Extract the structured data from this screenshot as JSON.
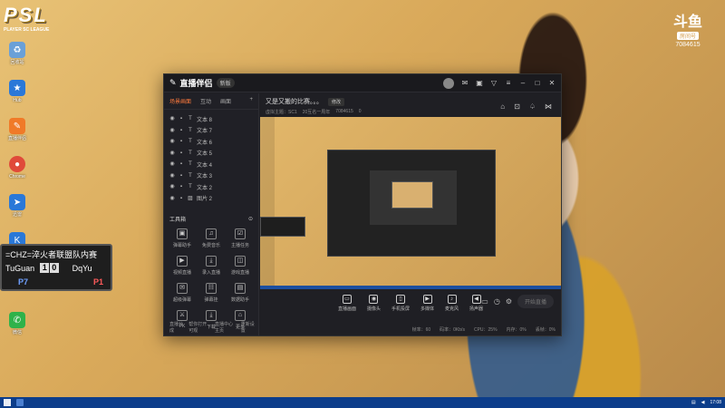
{
  "overlay": {
    "psl_logo_text": "PSL",
    "psl_subtitle": "PLAYER SC LEAGUE",
    "douyu_mark": "斗鱼",
    "douyu_tag": "房间号",
    "douyu_room": "7084615"
  },
  "desktop_icons": [
    {
      "label": "回收站",
      "color": "#6aa0d8",
      "icon": "recycle-bin-icon"
    },
    {
      "label": "Hub",
      "color": "#2a78d8",
      "icon": "star-icon"
    },
    {
      "label": "直播伴侣",
      "color": "#f07a28",
      "icon": "stream-companion-icon"
    },
    {
      "label": "Chrome",
      "color": "#e04a3a",
      "icon": "chrome-icon"
    },
    {
      "label": "迅雷",
      "color": "#2a78d8",
      "icon": "thunder-icon"
    },
    {
      "label": "KK",
      "color": "#2a78d8",
      "icon": "kk-icon"
    },
    {
      "label": "微信",
      "color": "#2fb24a",
      "icon": "wechat-icon"
    }
  ],
  "scoreboard": {
    "title": "=CHZ=淬火者联盟队内赛",
    "left_name": "TuGuan",
    "left_score": "1",
    "right_score": "0",
    "right_name": "DqYu",
    "left_player": "P7",
    "right_player": "P1"
  },
  "app": {
    "name": "直播伴侣",
    "badge": "新版",
    "tabs": [
      "场景画面",
      "互动",
      "画面"
    ],
    "sources": [
      "文本 8",
      "文本 7",
      "文本 6",
      "文本 5",
      "文本 4",
      "文本 3",
      "文本 2",
      "图片 2"
    ],
    "tools_title": "工具箱",
    "tools": [
      {
        "label": "弹幕助手",
        "glyph": "▣"
      },
      {
        "label": "免费音乐",
        "glyph": "♫"
      },
      {
        "label": "主播任务",
        "glyph": "☑"
      },
      {
        "label": "视频直播",
        "glyph": "▶"
      },
      {
        "label": "录入直播",
        "glyph": "⤓"
      },
      {
        "label": "游戏直播",
        "glyph": "◫"
      },
      {
        "label": "超级弹幕",
        "glyph": "✉"
      },
      {
        "label": "弹幕挂",
        "glyph": "☷"
      },
      {
        "label": "数据助手",
        "glyph": "▤"
      },
      {
        "label": "PK",
        "glyph": "⚔"
      },
      {
        "label": "下载",
        "glyph": "⤓"
      },
      {
        "label": "更多",
        "glyph": "⌂"
      }
    ],
    "footer": [
      "直播分成",
      "帮你打开可观",
      "直播中心主页",
      "重新设置"
    ],
    "stream_title": "又是又搬的比赛。。。",
    "edit_label": "修改",
    "sub_info": [
      "虚拟主题：SC1",
      "20互名一周年",
      "7084615",
      "0"
    ],
    "controls": [
      {
        "label": "直播画面",
        "glyph": "▭"
      },
      {
        "label": "摄像头",
        "glyph": "◉"
      },
      {
        "label": "手机投屏",
        "glyph": "▯"
      },
      {
        "label": "多媒体",
        "glyph": "▶"
      },
      {
        "label": "麦克风",
        "glyph": "♪"
      },
      {
        "label": "扬声器",
        "glyph": "◀"
      }
    ],
    "go_live": "开始直播",
    "status": [
      "帧率：60",
      "码率：0Kb/s",
      "CPU：25%",
      "内存：0%",
      "丢帧：0%"
    ]
  },
  "taskbar": {
    "time": "17:08"
  }
}
